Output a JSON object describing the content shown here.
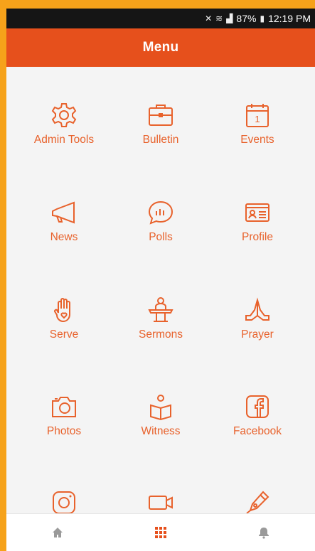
{
  "status_bar": {
    "battery": "87%",
    "time": "12:19 PM"
  },
  "header": {
    "title": "Menu"
  },
  "menu": [
    {
      "label": "Admin Tools",
      "icon": "gear-icon"
    },
    {
      "label": "Bulletin",
      "icon": "briefcase-icon"
    },
    {
      "label": "Events",
      "icon": "calendar-icon",
      "badge": "1"
    },
    {
      "label": "News",
      "icon": "megaphone-icon"
    },
    {
      "label": "Polls",
      "icon": "poll-bubble-icon"
    },
    {
      "label": "Profile",
      "icon": "id-card-icon"
    },
    {
      "label": "Serve",
      "icon": "hand-heart-icon"
    },
    {
      "label": "Sermons",
      "icon": "pulpit-icon"
    },
    {
      "label": "Prayer",
      "icon": "praying-hands-icon"
    },
    {
      "label": "Photos",
      "icon": "camera-icon"
    },
    {
      "label": "Witness",
      "icon": "reading-person-icon"
    },
    {
      "label": "Facebook",
      "icon": "facebook-icon"
    },
    {
      "label": "",
      "icon": "instagram-icon"
    },
    {
      "label": "",
      "icon": "video-camera-icon"
    },
    {
      "label": "",
      "icon": "pen-nib-icon"
    }
  ],
  "bottom_nav": [
    {
      "icon": "home-icon"
    },
    {
      "icon": "grid-icon",
      "active": true
    },
    {
      "icon": "bell-icon"
    }
  ],
  "colors": {
    "accent": "#e6501c",
    "icon": "#e8622c",
    "frame": "#f6a21a"
  }
}
